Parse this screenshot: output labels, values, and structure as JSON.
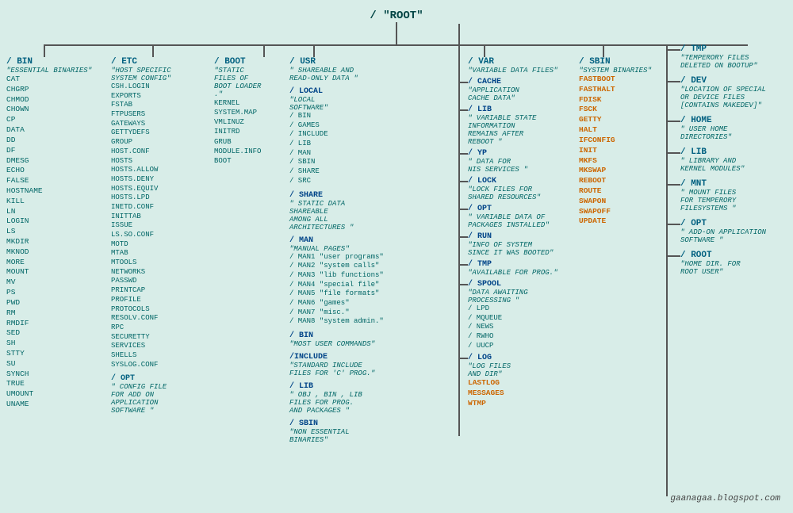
{
  "title": "/ \"ROOT\"",
  "watermark": "gaanagaa.blogspot.com",
  "nodes": {
    "bin": {
      "title": "/ BIN",
      "desc": "\"ESSENTIAL BINARIES\"",
      "items": [
        "CAT",
        "CHGRP",
        "CHMOD",
        "CHOWN",
        "CP",
        "DATA",
        "DD",
        "DF",
        "DMESG",
        "ECHO",
        "FALSE",
        "HOSTNAME",
        "KILL",
        "LN",
        "LOGIN",
        "LS",
        "MKDIR",
        "MKNOD",
        "MORE",
        "MOUNT",
        "MV",
        "PS",
        "PWD",
        "RM",
        "RMDIF",
        "SED",
        "SH",
        "STTY",
        "SU",
        "SYNCH",
        "TRUE",
        "UMOUNT",
        "UNAME"
      ]
    },
    "etc": {
      "title": "/ ETC",
      "desc": "\"HOST SPECIFIC SYSTEM CONFIG\"",
      "items": [
        "CSH.LOGIN",
        "EXPORTS",
        "FSTAB",
        "FTPUSERS",
        "GATEWAYS",
        "GETTYDEFS",
        "GROUP",
        "HOST.CONF",
        "HOSTS",
        "HOSTS.ALLOW",
        "HOSTS.DENY",
        "HOSTS.EQUIV",
        "HOSTS.LPD",
        "INETD.CONF",
        "INITTAB",
        "ISSUE",
        "LS.SO.CONF",
        "MOTD",
        "MTAB",
        "MTOOLS",
        "NETWORKS",
        "PASSWD",
        "PRINTCAP",
        "PROFILE",
        "PROTOCOLS",
        "RESOLV.CONF",
        "RPC",
        "SECURETTY",
        "SERVICES",
        "SHELLS",
        "SYSLOG.CONF"
      ],
      "opt": {
        "title": "/ OPT",
        "desc": "\" CONFIG FILE FOR ADD ON APPLICATION SOFTWARE \""
      }
    },
    "boot": {
      "title": "/ BOOT",
      "desc": "\"STATIC FILES OF BOOT LOADER .\"",
      "items": [
        "KERNEL",
        "SYSTEM.MAP",
        "VMLINUZ",
        "INITRD",
        "GRUB",
        "MODULE.INFO",
        "BOOT"
      ]
    },
    "usr": {
      "title": "/ USR",
      "desc": "\" SHAREABLE AND READ-ONLY DATA \"",
      "local": {
        "title": "/ LOCAL",
        "desc": "\"LOCAL SOFTWARE\"",
        "items": [
          "/ BIN",
          "/ GAMES",
          "/ INCLUDE",
          "/ LIB",
          "/ MAN",
          "/ SBIN",
          "/ SHARE",
          "/ SRC"
        ]
      },
      "share": {
        "title": "/ SHARE",
        "desc": "\" STATIC DATA SHAREABLE AMONG ALL ARCHITECTURES \""
      },
      "man": {
        "title": "/ MAN",
        "desc": "\"MANUAL PAGES\"",
        "items": [
          "/ MAN1 \"user programs\"",
          "/ MAN2 \"system calls\"",
          "/ MAN3 \"lib functions\"",
          "/ MAN4 \"special file\"",
          "/ MAN5 \"file formats\"",
          "/ MAN6 \"games\"",
          "/ MAN7 \"misc.\"",
          "/ MAN8 \"system admin.\""
        ]
      },
      "bin2": {
        "title": "/ BIN",
        "desc": "\"MOST USER COMMANDS\""
      },
      "include": {
        "title": "/INCLUDE",
        "desc": "\"STANDARD INCLUDE FILES FOR 'C' PROG.\""
      },
      "lib": {
        "title": "/ LIB",
        "desc": "\" OBJ , BIN , LIB FILES FOR PROG. AND PACKAGES \""
      },
      "sbin": {
        "title": "/ SBIN",
        "desc": "\"NON ESSENTIAL BINARIES\""
      }
    },
    "var": {
      "title": "/ VAR",
      "desc": "\"VARIABLE DATA FILES\"",
      "cache": {
        "title": "/ CACHE",
        "desc": "\"APPLICATION CACHE DATA\""
      },
      "lib": {
        "title": "/ LIB",
        "desc": "\" VARIABLE STATE INFORMATION REMAINS AFTER REBOOT \""
      },
      "yp": {
        "title": "/ YP",
        "desc": "\" DATA FOR NIS SERVICES \""
      },
      "lock": {
        "title": "/ LOCK",
        "desc": "\"LOCK FILES FOR SHARED RESOURCES\""
      },
      "opt": {
        "title": "/ OPT",
        "desc": "\" VARIABLE DATA OF PACKAGES INSTALLED\""
      },
      "run": {
        "title": "/ RUN",
        "desc": "\"INFO OF SYSTEM SINCE IT WAS BOOTED\""
      },
      "tmp": {
        "title": "/ TMP",
        "desc": "\"AVAILABLE FOR PROG.\""
      },
      "spool": {
        "title": "/ SPOOL",
        "desc": "\"DATA AWAITING PROCESSING \"",
        "items": [
          "/ LPD",
          "/ MQUEUE",
          "/ NEWS",
          "/ RWHO",
          "/ UUCP"
        ]
      },
      "log": {
        "title": "/ LOG",
        "desc": "\"LOG FILES AND DIR\"",
        "items_orange": [
          "LASTLOG",
          "MESSAGES",
          "WTMP"
        ]
      }
    },
    "sbin": {
      "title": "/ SBIN",
      "desc": "\"SYSTEM BINARIES\"",
      "items_orange": [
        "FASTBOOT",
        "FASTHALT",
        "FDISK",
        "FSCK",
        "GETTY",
        "HALT",
        "IFCONFIG",
        "INIT",
        "MKFS",
        "MKSWAP",
        "REBOOT",
        "ROUTE",
        "SWAPON",
        "SWAPOFF",
        "UPDATE"
      ]
    },
    "tmp": {
      "title": "/ TMP",
      "desc": "\"TEMPERORY FILES DELETED ON BOOTUP\""
    },
    "dev": {
      "title": "/ DEV",
      "desc": "\"LOCATION OF SPECIAL OR DEVICE FILES [CONTAINS MAKEDEV]\""
    },
    "home": {
      "title": "/ HOME",
      "desc": "\" USER HOME DIRECTORIES\""
    },
    "lib": {
      "title": "/ LIB",
      "desc": "\"  LIBRARY AND KERNEL MODULES\""
    },
    "mnt": {
      "title": "/ MNT",
      "desc": "\"  MOUNT FILES FOR TEMPERORY FILESYSTEMS \""
    },
    "opt": {
      "title": "/ OPT",
      "desc": "\" ADD-ON APPLICATION SOFTWARE \""
    },
    "root": {
      "title": "/ ROOT",
      "desc": "\"HOME DIR. FOR ROOT USER\""
    }
  }
}
